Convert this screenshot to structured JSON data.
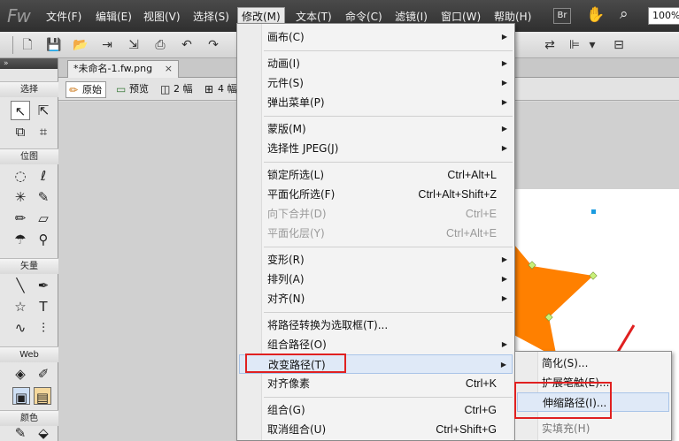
{
  "app": {
    "logo": "Fw"
  },
  "menubar": {
    "items": [
      {
        "label": "文件(F)"
      },
      {
        "label": "编辑(E)"
      },
      {
        "label": "视图(V)"
      },
      {
        "label": "选择(S)"
      },
      {
        "label": "修改(M)",
        "active": true
      },
      {
        "label": "文本(T)"
      },
      {
        "label": "命令(C)"
      },
      {
        "label": "滤镜(I)"
      },
      {
        "label": "窗口(W)"
      },
      {
        "label": "帮助(H)"
      }
    ],
    "br_label": "Br",
    "zoom": "100%"
  },
  "tools_panel": {
    "sections": [
      "选择",
      "位图",
      "矢量",
      "Web",
      "颜色"
    ]
  },
  "document": {
    "tab_title": "*未命名-1.fw.png",
    "tab_close": "×",
    "views": [
      {
        "label": "原始",
        "active": true
      },
      {
        "label": "预览"
      },
      {
        "label": "2 幅"
      },
      {
        "label": "4 幅"
      }
    ]
  },
  "modify_menu": {
    "items": [
      {
        "label": "画布(C)",
        "submenu": true
      },
      {
        "label": "动画(I)",
        "submenu": true
      },
      {
        "label": "元件(S)",
        "submenu": true
      },
      {
        "label": "弹出菜单(P)",
        "submenu": true
      },
      {
        "label": "蒙版(M)",
        "submenu": true
      },
      {
        "label": "选择性 JPEG(J)",
        "submenu": true
      },
      {
        "label": "锁定所选(L)",
        "shortcut": "Ctrl+Alt+L"
      },
      {
        "label": "平面化所选(F)",
        "shortcut": "Ctrl+Alt+Shift+Z"
      },
      {
        "label": "向下合并(D)",
        "shortcut": "Ctrl+E",
        "disabled": true
      },
      {
        "label": "平面化层(Y)",
        "shortcut": "Ctrl+Alt+E",
        "disabled": true
      },
      {
        "label": "变形(R)",
        "submenu": true
      },
      {
        "label": "排列(A)",
        "submenu": true
      },
      {
        "label": "对齐(N)",
        "submenu": true
      },
      {
        "label": "将路径转换为选取框(T)..."
      },
      {
        "label": "组合路径(O)",
        "submenu": true
      },
      {
        "label": "改变路径(T)",
        "submenu": true,
        "highlighted": true
      },
      {
        "label": "对齐像素",
        "shortcut": "Ctrl+K"
      },
      {
        "label": "组合(G)",
        "shortcut": "Ctrl+G"
      },
      {
        "label": "取消组合(U)",
        "shortcut": "Ctrl+Shift+G"
      }
    ]
  },
  "submenu": {
    "items": [
      {
        "label": "简化(S)..."
      },
      {
        "label": "扩展笔触(E)..."
      },
      {
        "label": "伸缩路径(I)...",
        "highlighted": true
      },
      {
        "label": "实填充(H)"
      }
    ]
  },
  "colors": {
    "star": "#ff8000",
    "highlight_box": "#e02020",
    "arrow": "#e02020"
  }
}
